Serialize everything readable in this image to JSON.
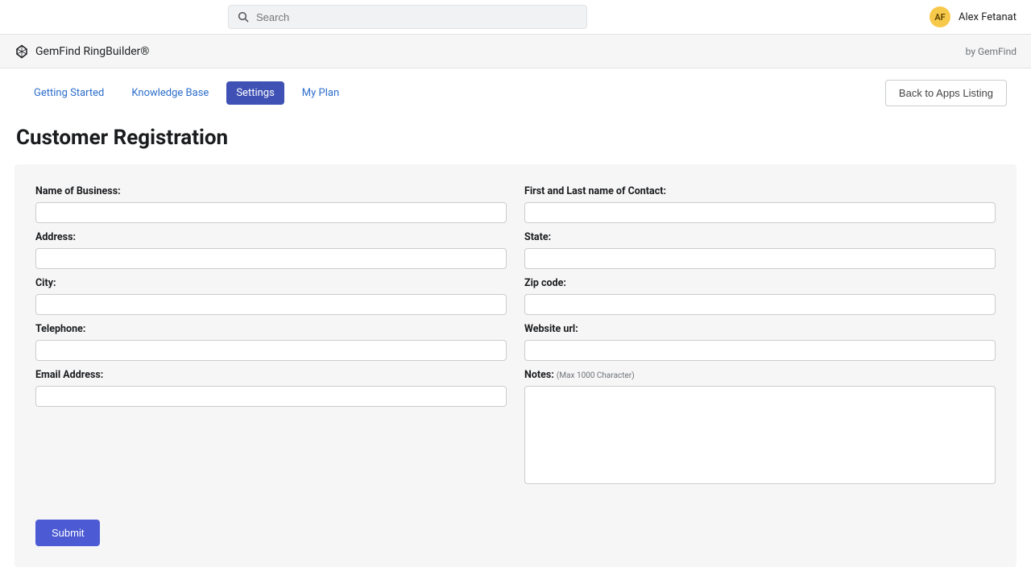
{
  "header": {
    "search_placeholder": "Search",
    "avatar_initials": "AF",
    "user_name": "Alex Fetanat"
  },
  "app_bar": {
    "title": "GemFind RingBuilder®",
    "by_text": "by GemFind"
  },
  "tabs": {
    "getting_started": "Getting Started",
    "knowledge_base": "Knowledge Base",
    "settings": "Settings",
    "my_plan": "My Plan"
  },
  "buttons": {
    "back": "Back to Apps Listing",
    "submit": "Submit"
  },
  "page_title": "Customer Registration",
  "form": {
    "left": {
      "business": "Name of Business:",
      "address": "Address:",
      "city": "City:",
      "telephone": "Telephone:",
      "email": "Email Address:"
    },
    "right": {
      "contact": "First and Last name of Contact:",
      "state": "State:",
      "zip": "Zip code:",
      "website": "Website url:",
      "notes": "Notes:",
      "notes_hint": "(Max 1000 Character)"
    }
  }
}
